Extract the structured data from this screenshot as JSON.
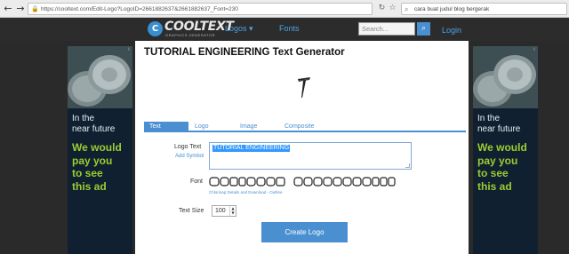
{
  "browser": {
    "url": "https://cooltext.com/Edit-Logo?LogoID=2661882637&2661882637_Font=230",
    "search_query": "cara buat judul blog bergerak"
  },
  "header": {
    "logo_word": "COOLTEXT",
    "logo_sub": "GRAPHICS GENERATOR",
    "nav_logos": "Logos ▾",
    "nav_fonts": "Fonts",
    "search_placeholder": "Search...",
    "login": "Login"
  },
  "main": {
    "title": "TUTORIAL ENGINEERING Text Generator",
    "tabs": [
      {
        "label": "Text",
        "active": true
      },
      {
        "label": "Logo"
      },
      {
        "label": "Image"
      },
      {
        "label": "Composite"
      }
    ],
    "logo_text_label": "Logo Text",
    "add_symbol": "Add Symbol",
    "logo_text_value": "TUTORIAL ENGINEERING",
    "font_label": "Font",
    "font_links": "Chlorinap Details and Download - Outline",
    "text_size_label": "Text Size",
    "text_size_value": "100",
    "create_button": "Create Logo"
  },
  "ads": {
    "line1": [
      "In the",
      "near future"
    ],
    "line2": [
      "We would",
      "pay you",
      "to see",
      "this ad"
    ]
  },
  "colors": {
    "accent": "#4a8fd0",
    "header_bg": "#2c2c2c",
    "ad_bg": "#102030",
    "ad_green": "#9acd32"
  }
}
